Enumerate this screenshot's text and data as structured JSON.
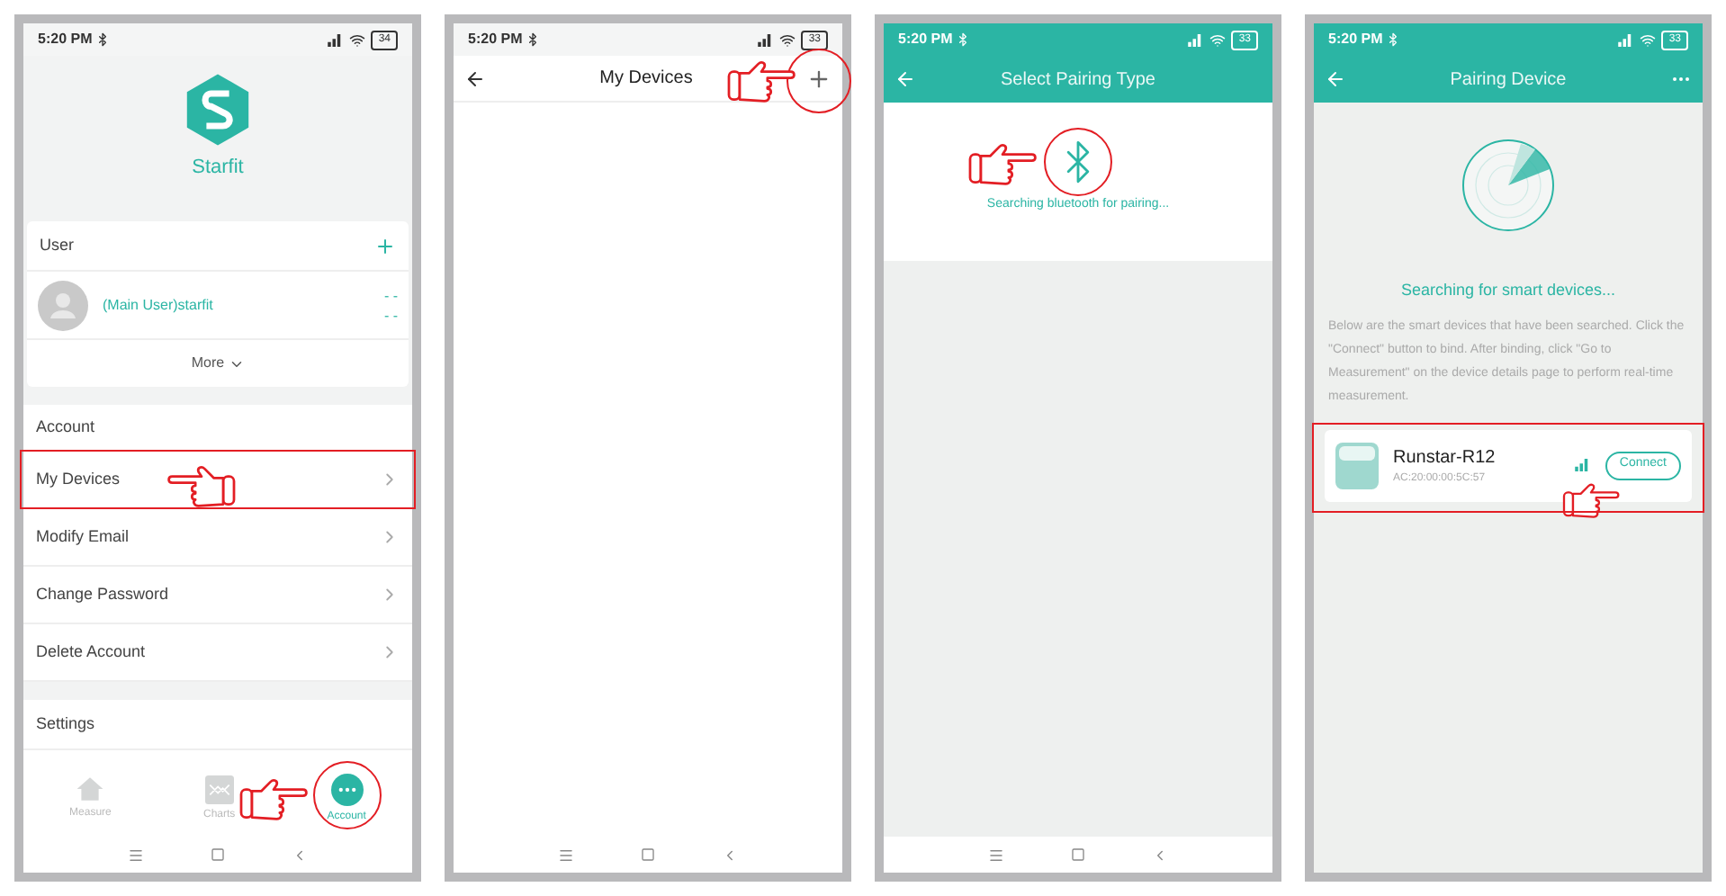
{
  "screens": [
    {
      "kind": "account",
      "status": {
        "time": "5:20 PM",
        "battery": "34"
      },
      "app_name": "Starfit",
      "user_header": "User",
      "user": {
        "name": "(Main User)starfit",
        "reading_1": "- -",
        "reading_2": "- -"
      },
      "more": "More",
      "account_header": "Account",
      "menu": [
        {
          "label": "My Devices",
          "highlighted": true
        },
        {
          "label": "Modify Email",
          "highlighted": false
        },
        {
          "label": "Change Password",
          "highlighted": false
        },
        {
          "label": "Delete Account",
          "highlighted": false
        }
      ],
      "settings": "Settings",
      "tabs": [
        {
          "label": "Measure",
          "selected": false
        },
        {
          "label": "Charts",
          "selected": false
        },
        {
          "label": "Account",
          "selected": true
        }
      ]
    },
    {
      "kind": "devices",
      "status": {
        "time": "5:20 PM",
        "battery": "33"
      },
      "title": "My Devices"
    },
    {
      "kind": "pairing_type",
      "status": {
        "time": "5:20 PM",
        "battery": "33"
      },
      "title": "Select Pairing Type",
      "message": "Searching bluetooth for pairing..."
    },
    {
      "kind": "pairing",
      "status": {
        "time": "5:20 PM",
        "battery": "33"
      },
      "title": "Pairing Device",
      "heading": "Searching for smart devices...",
      "description": "Below are the smart devices that have been searched. Click the \"Connect\" button to bind. After binding, click \"Go to Measurement\" on the device details page to perform real-time measurement.",
      "device": {
        "name": "Runstar-R12",
        "mac": "AC:20:00:00:5C:57",
        "button": "Connect"
      }
    }
  ]
}
